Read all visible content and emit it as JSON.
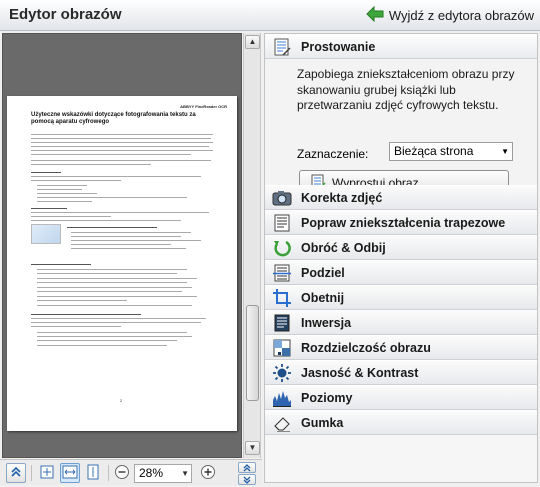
{
  "app": {
    "title": "Edytor obrazów"
  },
  "header": {
    "exit_label": "Wyjdź z edytora obrazów"
  },
  "preview": {
    "page_header": "ABBYY FineReader OCR",
    "page_title": "Użyteczne wskazówki dotyczące fotografowania tekstu za pomocą aparatu cyfrowego",
    "page_number": "2"
  },
  "bottom_toolbar": {
    "zoom_value": "28%"
  },
  "panel": {
    "open_section": {
      "label": "Prostowanie",
      "description": "Zapobiega zniekształceniom obrazu przy skanowaniu grubej książki lub przetwarzaniu zdjęć cyfrowych tekstu.",
      "selection_label": "Zaznaczenie:",
      "selection_value": "Bieżąca strona",
      "button_label": "Wyprostuj obraz"
    },
    "sections": [
      {
        "label": "Korekta zdjęć",
        "icon": "camera-icon"
      },
      {
        "label": "Popraw zniekształcenia trapezowe",
        "icon": "trapezoid-icon"
      },
      {
        "label": "Obróć & Odbij",
        "icon": "rotate-icon"
      },
      {
        "label": "Podziel",
        "icon": "split-icon"
      },
      {
        "label": "Obetnij",
        "icon": "crop-icon"
      },
      {
        "label": "Inwersja",
        "icon": "invert-icon"
      },
      {
        "label": "Rozdzielczość obrazu",
        "icon": "resolution-icon"
      },
      {
        "label": "Jasność & Kontrast",
        "icon": "brightness-icon"
      },
      {
        "label": "Poziomy",
        "icon": "levels-icon"
      },
      {
        "label": "Gumka",
        "icon": "eraser-icon"
      }
    ]
  }
}
